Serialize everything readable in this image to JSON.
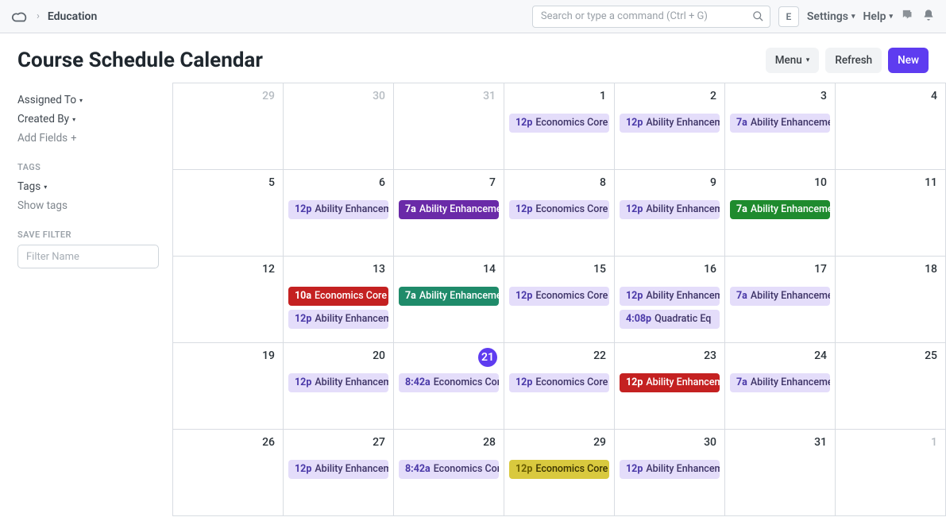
{
  "breadcrumb": "Education",
  "search": {
    "placeholder": "Search or type a command (Ctrl + G)"
  },
  "user_initial": "E",
  "top_links": {
    "settings": "Settings",
    "help": "Help"
  },
  "page_title": "Course Schedule Calendar",
  "buttons": {
    "menu": "Menu",
    "refresh": "Refresh",
    "new": "New"
  },
  "sidebar": {
    "assigned_to": "Assigned To",
    "created_by": "Created By",
    "add_fields": "Add Fields",
    "tags_heading": "TAGS",
    "tags": "Tags",
    "show_tags": "Show tags",
    "save_filter_heading": "SAVE FILTER",
    "filter_placeholder": "Filter Name"
  },
  "calendar": {
    "weeks": [
      {
        "days": [
          {
            "num": "29",
            "faded": true,
            "events": []
          },
          {
            "num": "30",
            "faded": true,
            "events": []
          },
          {
            "num": "31",
            "faded": true,
            "events": []
          },
          {
            "num": "1",
            "events": [
              {
                "time": "12p",
                "name": "Economics Core",
                "color": "light"
              }
            ]
          },
          {
            "num": "2",
            "events": [
              {
                "time": "12p",
                "name": "Ability Enhancement",
                "color": "light"
              }
            ]
          },
          {
            "num": "3",
            "events": [
              {
                "time": "7a",
                "name": "Ability Enhancement",
                "color": "light"
              }
            ]
          },
          {
            "num": "4",
            "events": []
          }
        ]
      },
      {
        "days": [
          {
            "num": "5",
            "events": []
          },
          {
            "num": "6",
            "events": [
              {
                "time": "12p",
                "name": "Ability Enhancement",
                "color": "light"
              }
            ]
          },
          {
            "num": "7",
            "events": [
              {
                "time": "7a",
                "name": "Ability Enhancement",
                "color": "purple"
              }
            ]
          },
          {
            "num": "8",
            "events": [
              {
                "time": "12p",
                "name": "Economics Core",
                "color": "light"
              }
            ]
          },
          {
            "num": "9",
            "events": [
              {
                "time": "12p",
                "name": "Ability Enhancement",
                "color": "light"
              }
            ]
          },
          {
            "num": "10",
            "events": [
              {
                "time": "7a",
                "name": "Ability Enhancement",
                "color": "green"
              }
            ]
          },
          {
            "num": "11",
            "events": []
          }
        ]
      },
      {
        "days": [
          {
            "num": "12",
            "events": []
          },
          {
            "num": "13",
            "events": [
              {
                "time": "10a",
                "name": "Economics Core",
                "color": "red"
              },
              {
                "time": "12p",
                "name": "Ability Enhancement",
                "color": "light"
              }
            ]
          },
          {
            "num": "14",
            "events": [
              {
                "time": "7a",
                "name": "Ability Enhancement",
                "color": "teal"
              }
            ]
          },
          {
            "num": "15",
            "events": [
              {
                "time": "12p",
                "name": "Economics Core",
                "color": "light"
              }
            ]
          },
          {
            "num": "16",
            "events": [
              {
                "time": "12p",
                "name": "Ability Enhancement",
                "color": "light"
              },
              {
                "time": "4:08p",
                "name": "Quadratic Eq",
                "color": "light"
              }
            ]
          },
          {
            "num": "17",
            "events": [
              {
                "time": "7a",
                "name": "Ability Enhancement",
                "color": "light"
              }
            ]
          },
          {
            "num": "18",
            "events": []
          }
        ]
      },
      {
        "days": [
          {
            "num": "19",
            "events": []
          },
          {
            "num": "20",
            "events": [
              {
                "time": "12p",
                "name": "Ability Enhancement",
                "color": "light"
              }
            ]
          },
          {
            "num": "21",
            "today": true,
            "events": [
              {
                "time": "8:42a",
                "name": "Economics Core",
                "color": "light"
              }
            ]
          },
          {
            "num": "22",
            "events": [
              {
                "time": "12p",
                "name": "Economics Core",
                "color": "light"
              }
            ]
          },
          {
            "num": "23",
            "events": [
              {
                "time": "12p",
                "name": "Ability Enhancement",
                "color": "red"
              }
            ]
          },
          {
            "num": "24",
            "events": [
              {
                "time": "7a",
                "name": "Ability Enhancement",
                "color": "light"
              }
            ]
          },
          {
            "num": "25",
            "events": []
          }
        ]
      },
      {
        "days": [
          {
            "num": "26",
            "events": []
          },
          {
            "num": "27",
            "events": [
              {
                "time": "12p",
                "name": "Ability Enhancement",
                "color": "light"
              }
            ]
          },
          {
            "num": "28",
            "events": [
              {
                "time": "8:42a",
                "name": "Economics Core",
                "color": "light"
              }
            ]
          },
          {
            "num": "29",
            "events": [
              {
                "time": "12p",
                "name": "Economics Core",
                "color": "olive"
              }
            ]
          },
          {
            "num": "30",
            "events": [
              {
                "time": "12p",
                "name": "Ability Enhancement",
                "color": "light"
              }
            ]
          },
          {
            "num": "31",
            "events": []
          },
          {
            "num": "1",
            "faded": true,
            "events": []
          }
        ]
      }
    ]
  }
}
